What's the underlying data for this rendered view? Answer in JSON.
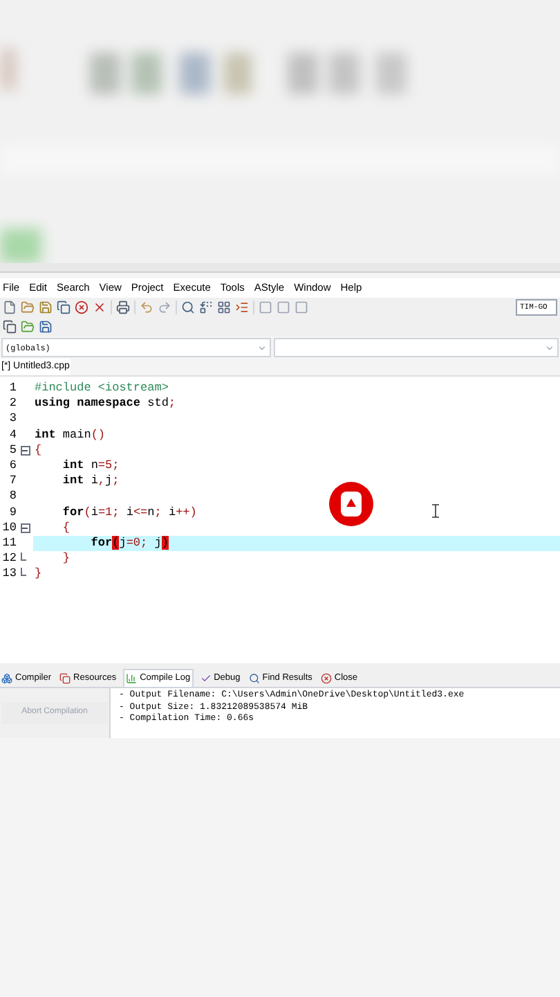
{
  "menu": [
    "File",
    "Edit",
    "Search",
    "View",
    "Project",
    "Execute",
    "Tools",
    "AStyle",
    "Window",
    "Help"
  ],
  "toolbar_field": {
    "value": "TIM-GO"
  },
  "scope_select": {
    "value": "(globals)"
  },
  "file_tab": {
    "label": "[*] Untitled3.cpp",
    "selected": true
  },
  "code": [
    {
      "number": "1",
      "selected": false,
      "tokens": [
        {
          "kind": "pre",
          "text": "#include <iostream>"
        }
      ]
    },
    {
      "number": "2",
      "selected": false,
      "tokens": [
        {
          "kind": "kw",
          "text": "using namespace"
        },
        {
          "kind": "plain",
          "text": " std"
        },
        {
          "kind": "sym",
          "text": ";"
        }
      ]
    },
    {
      "number": "3",
      "selected": false
    },
    {
      "number": "4",
      "selected": false,
      "tokens": [
        {
          "kind": "kw",
          "text": "int"
        },
        {
          "kind": "plain",
          "text": " main"
        },
        {
          "kind": "sym",
          "text": "()"
        }
      ]
    },
    {
      "number": "5",
      "selected": false,
      "fold_start": true,
      "tokens": [
        {
          "kind": "sym",
          "text": "{"
        }
      ]
    },
    {
      "number": "6",
      "selected": false,
      "tokens": [
        {
          "kind": "kw",
          "text": "    int"
        },
        {
          "kind": "plain",
          "text": " n"
        },
        {
          "kind": "sym",
          "text": "=5;"
        }
      ]
    },
    {
      "number": "7",
      "selected": false,
      "tokens": [
        {
          "kind": "kw",
          "text": "    int"
        },
        {
          "kind": "plain",
          "text": " i"
        },
        {
          "kind": "sym",
          "text": ","
        },
        {
          "kind": "plain",
          "text": "j"
        },
        {
          "kind": "sym",
          "text": ";"
        }
      ]
    },
    {
      "number": "8",
      "selected": false
    },
    {
      "number": "9",
      "selected": false,
      "tokens": [
        {
          "kind": "kw",
          "text": "    for"
        },
        {
          "kind": "sym",
          "text": "("
        },
        {
          "kind": "plain",
          "text": "i"
        },
        {
          "kind": "sym",
          "text": "=1; "
        },
        {
          "kind": "plain",
          "text": "i"
        },
        {
          "kind": "sym",
          "text": "<="
        },
        {
          "kind": "plain",
          "text": "n"
        },
        {
          "kind": "sym",
          "text": "; "
        },
        {
          "kind": "plain",
          "text": "i"
        },
        {
          "kind": "sym",
          "text": "++)"
        }
      ]
    },
    {
      "number": "10",
      "selected": false,
      "fold_start": true,
      "tokens": [
        {
          "kind": "sym",
          "text": "    {"
        }
      ]
    },
    {
      "number": "11",
      "selected": true,
      "tokens": [
        {
          "kind": "kw",
          "text": "        for"
        },
        {
          "kind": "match",
          "text": "("
        },
        {
          "kind": "plain",
          "text": "j"
        },
        {
          "kind": "sym",
          "text": "=0; "
        },
        {
          "kind": "plain",
          "text": "j"
        },
        {
          "kind": "match",
          "text": ")"
        }
      ]
    },
    {
      "number": "12",
      "selected": false,
      "fold_end": true,
      "tokens": [
        {
          "kind": "sym",
          "text": "    }"
        }
      ]
    },
    {
      "number": "13",
      "selected": false,
      "fold_end": true,
      "tokens": [
        {
          "kind": "sym",
          "text": "}"
        }
      ]
    }
  ],
  "bottom_tabs": [
    {
      "label": "Compiler",
      "selected": false
    },
    {
      "label": "Resources",
      "selected": false
    },
    {
      "label": "Compile Log",
      "selected": true
    },
    {
      "label": "Debug",
      "selected": false
    },
    {
      "label": "Find Results",
      "selected": false
    },
    {
      "label": "Close",
      "selected": false
    }
  ],
  "abort_button": {
    "label": "Abort Compilation",
    "disabled": true
  },
  "log": [
    "- Output Filename: C:\\Users\\Admin\\OneDrive\\Desktop\\Untitled3.exe",
    "- Output Size: 1.83212089538574 MiB",
    "- Compilation Time: 0.66s"
  ]
}
